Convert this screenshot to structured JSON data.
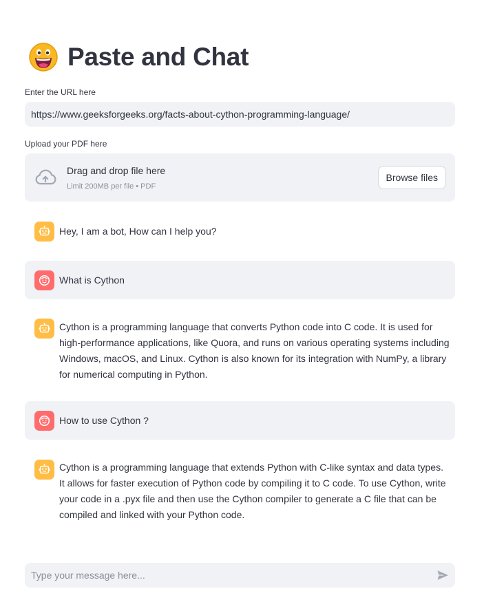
{
  "header": {
    "title": "Paste and Chat",
    "emoji": "laughing-face-emoji"
  },
  "url_field": {
    "label": "Enter the URL here",
    "value": "https://www.geeksforgeeks.org/facts-about-cython-programming-language/"
  },
  "upload": {
    "label": "Upload your PDF here",
    "drop_text": "Drag and drop file here",
    "limit_text": "Limit 200MB per file • PDF",
    "browse_label": "Browse files",
    "icon": "cloud-upload-icon"
  },
  "messages": [
    {
      "role": "assistant",
      "avatar_icon": "robot-icon",
      "text": "Hey, I am a bot, How can I help you?"
    },
    {
      "role": "user",
      "avatar_icon": "smiley-face-icon",
      "text": "What is Cython"
    },
    {
      "role": "assistant",
      "avatar_icon": "robot-icon",
      "text": "Cython is a programming language that converts Python code into C code. It is used for high-performance applications, like Quora, and runs on various operating systems including Windows, macOS, and Linux. Cython is also known for its integration with NumPy, a library for numerical computing in Python."
    },
    {
      "role": "user",
      "avatar_icon": "smiley-face-icon",
      "text": "How to use Cython ?"
    },
    {
      "role": "assistant",
      "avatar_icon": "robot-icon",
      "text": "Cython is a programming language that extends Python with C-like syntax and data types. It allows for faster execution of Python code by compiling it to C code. To use Cython, write your code in a .pyx file and then use the Cython compiler to generate a C file that can be compiled and linked with your Python code."
    }
  ],
  "chat_input": {
    "placeholder": "Type your message here...",
    "send_icon": "send-icon"
  },
  "colors": {
    "text": "#31333f",
    "input_bg": "#f0f2f6",
    "bot_avatar": "#ffbd45",
    "user_avatar": "#ff6c6c",
    "muted": "#8c8f98"
  }
}
